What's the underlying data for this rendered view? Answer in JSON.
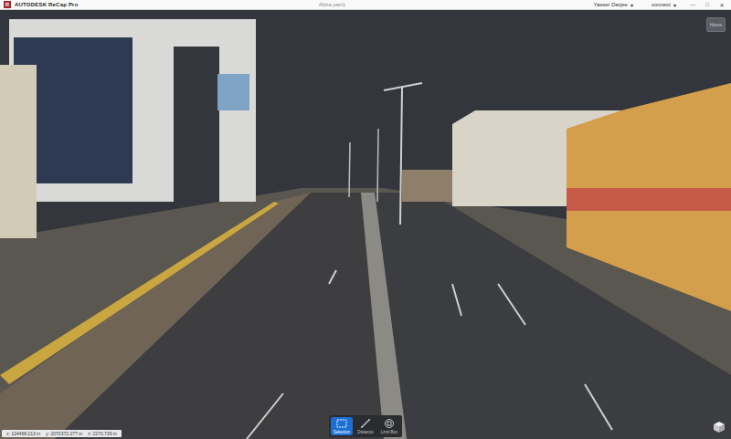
{
  "window": {
    "logo": "R",
    "app": "AUTODESK ReCap Pro",
    "title": "Abha part1",
    "user": "Yasser Darjee",
    "user_caret": "▾",
    "connect": "connect",
    "connect_caret": "▾",
    "controls": [
      "—",
      "□",
      "✕"
    ]
  },
  "viewport": {
    "home_button": "Home"
  },
  "coordinates": [
    "x: 124468.213 m",
    "y: 2070372.277 m",
    "z: 2270.739 m"
  ],
  "toolbar": [
    {
      "label": "Selection",
      "selected": true
    },
    {
      "label": "Distance",
      "selected": false
    },
    {
      "label": "Limit Box",
      "selected": false
    }
  ]
}
